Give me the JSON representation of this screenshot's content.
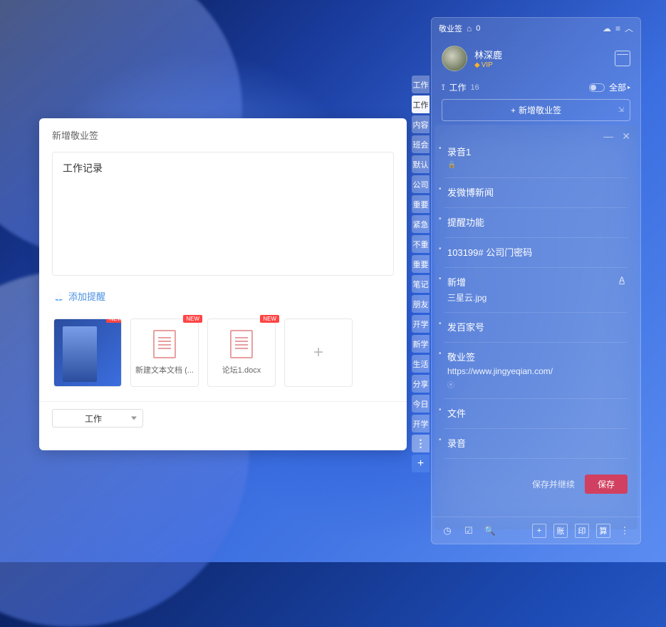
{
  "dialog": {
    "title": "新增敬业签",
    "noteText": "工作记录",
    "reminderLabel": "添加提醒",
    "attachments": [
      {
        "type": "image",
        "badge": "NEW",
        "label": ""
      },
      {
        "type": "doc",
        "badge": "NEW",
        "label": "新建文本文档 (..."
      },
      {
        "type": "doc",
        "badge": "NEW",
        "label": "论坛1.docx"
      }
    ],
    "categorySelected": "工作"
  },
  "sideTabs": [
    "工作",
    "工作",
    "内容",
    "班会",
    "默认",
    "公司",
    "重要",
    "紧急",
    "不重",
    "重要",
    "笔记",
    "朋友",
    "开学",
    "新学",
    "生活",
    "分享",
    "今日",
    "开学"
  ],
  "panel": {
    "appName": "敬业签",
    "notifCount": "0",
    "username": "林深鹿",
    "vip": "VIP",
    "sectionLabel": "工作",
    "sectionCount": "16",
    "filterAll": "全部",
    "addNoteLabel": "新增敬业签",
    "notes": [
      {
        "title": "录音1",
        "lock": true
      },
      {
        "title": "发微博新闻"
      },
      {
        "title": "提醒功能"
      },
      {
        "title": "103199# 公司门密码"
      },
      {
        "title": "新增",
        "sub": "三星云.jpg",
        "aa": true
      },
      {
        "title": "发百家号"
      },
      {
        "title": "敬业签",
        "sub": "https://www.jingyeqian.com/",
        "link": true
      },
      {
        "title": "文件"
      },
      {
        "title": "录音"
      }
    ],
    "saveContinue": "保存并继续",
    "save": "保存",
    "bottomBtns": [
      "账",
      "印",
      "算"
    ]
  }
}
